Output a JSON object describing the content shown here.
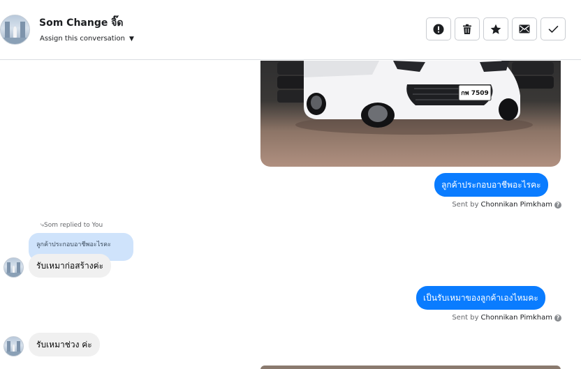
{
  "header": {
    "contact_name": "Som Change จิ๊ด",
    "assign_label": "Assign this conversation",
    "actions": [
      {
        "name": "mark-spam-button",
        "icon": "alert-circle-icon"
      },
      {
        "name": "delete-button",
        "icon": "trash-icon"
      },
      {
        "name": "star-button",
        "icon": "star-icon"
      },
      {
        "name": "mark-unread-button",
        "icon": "envelope-icon"
      },
      {
        "name": "mark-done-button",
        "icon": "checkmark-icon"
      }
    ]
  },
  "photo": {
    "plate_text": "กพ 7509"
  },
  "messages": [
    {
      "direction": "outgoing",
      "text": "ลูกค้าประกอบอาชีพอะไรคะ",
      "sent_by_prefix": "Sent by",
      "sent_by_name": "Chonnikan Pimkham"
    },
    {
      "direction": "incoming",
      "reply_note": "Som replied to You",
      "quoted_text": "ลูกค้าประกอบอาชีพอะไรคะ",
      "text": "รับเหมาก่อสร้างค่ะ"
    },
    {
      "direction": "outgoing",
      "text": "เป็นรับเหมาของลูกค้าเองไหมคะ",
      "sent_by_prefix": "Sent by",
      "sent_by_name": "Chonnikan Pimkham"
    },
    {
      "direction": "incoming",
      "text": "รับเหมาช่วง ค่ะ"
    }
  ],
  "colors": {
    "outgoing_bubble": "#0a7cff",
    "incoming_bubble": "#f0f0f0",
    "quoted_bubble": "#cfe3fb",
    "meta_text": "#65676b"
  }
}
